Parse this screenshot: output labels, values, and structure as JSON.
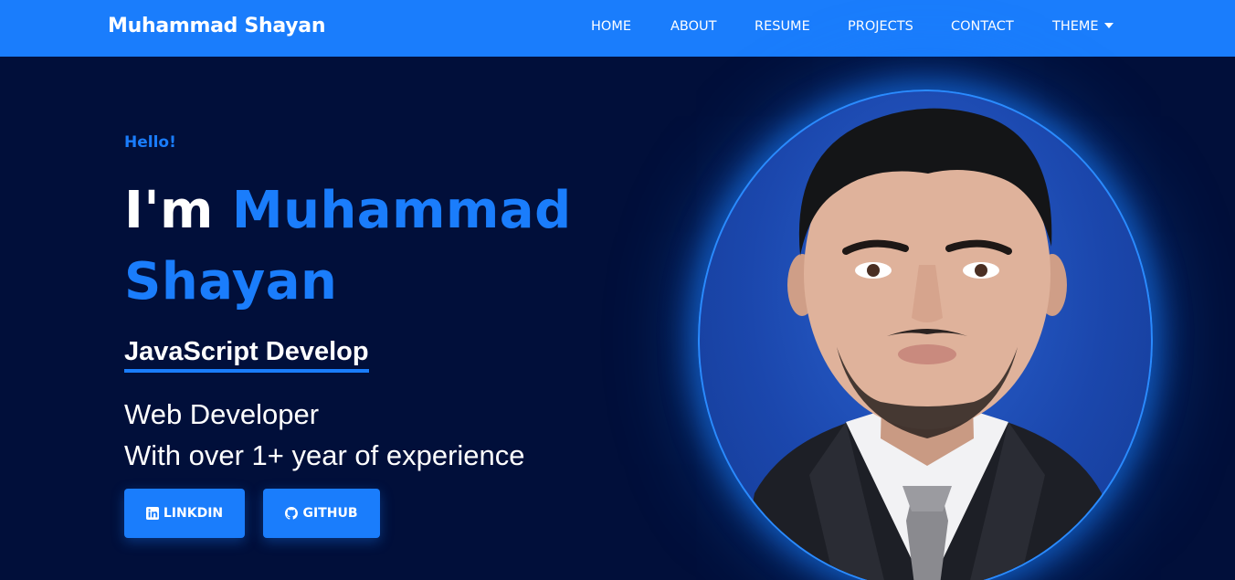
{
  "navbar": {
    "brand": "Muhammad Shayan",
    "links": [
      {
        "label": "HOME"
      },
      {
        "label": "ABOUT"
      },
      {
        "label": "RESUME"
      },
      {
        "label": "PROJECTS"
      },
      {
        "label": "CONTACT"
      },
      {
        "label": "THEME",
        "icon": "caret-down-icon"
      }
    ]
  },
  "hero": {
    "greeting": "Hello!",
    "headline_prefix": "I'm",
    "headline_name": "Muhammad Shayan",
    "typed_text": "JavaScript Develop",
    "role": "Web Developer",
    "experience": "With over 1+ year of experience",
    "buttons": {
      "linkedin": {
        "label": "LINKDIN",
        "icon": "linkedin-icon"
      },
      "github": {
        "label": "GITHUB",
        "icon": "github-icon"
      }
    },
    "photo": {
      "alt": "profile-photo"
    }
  },
  "colors": {
    "primary": "#1a7dfc",
    "background": "#010f3a",
    "text": "#ffffff"
  }
}
